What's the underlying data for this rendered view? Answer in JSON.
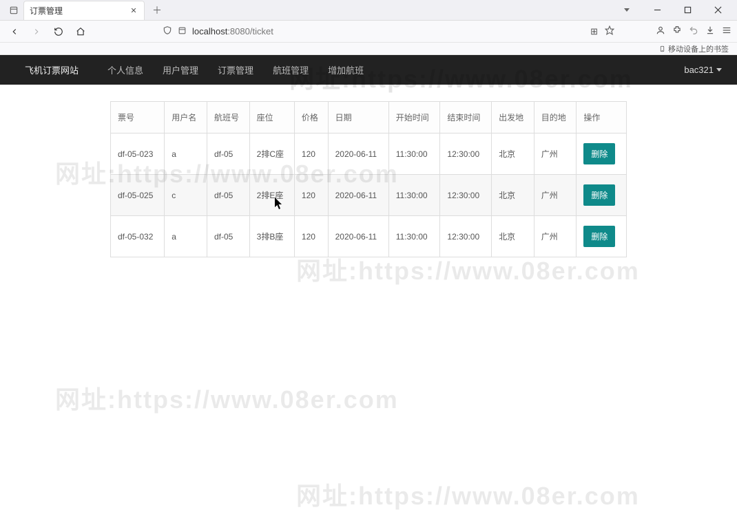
{
  "browser": {
    "tab_title": "订票管理",
    "url_host": "localhost",
    "url_port": ":8080",
    "url_path": "/ticket",
    "bookmarks_label": "移动设备上的书签"
  },
  "nav": {
    "brand": "飞机订票网站",
    "items": [
      "个人信息",
      "用户管理",
      "订票管理",
      "航班管理",
      "增加航班"
    ],
    "user": "bac321"
  },
  "table": {
    "headers": [
      "票号",
      "用户名",
      "航班号",
      "座位",
      "价格",
      "日期",
      "开始时间",
      "结束时间",
      "出发地",
      "目的地",
      "操作"
    ],
    "delete_label": "删除",
    "rows": [
      {
        "ticket": "df-05-023",
        "user": "a",
        "flight": "df-05",
        "seat": "2排C座",
        "price": "120",
        "date": "2020-06-11",
        "start": "11:30:00",
        "end": "12:30:00",
        "from": "北京",
        "to": "广州"
      },
      {
        "ticket": "df-05-025",
        "user": "c",
        "flight": "df-05",
        "seat": "2排E座",
        "price": "120",
        "date": "2020-06-11",
        "start": "11:30:00",
        "end": "12:30:00",
        "from": "北京",
        "to": "广州"
      },
      {
        "ticket": "df-05-032",
        "user": "a",
        "flight": "df-05",
        "seat": "3排B座",
        "price": "120",
        "date": "2020-06-11",
        "start": "11:30:00",
        "end": "12:30:00",
        "from": "北京",
        "to": "广州"
      }
    ]
  },
  "watermark": "网址:https://www.08er.com"
}
